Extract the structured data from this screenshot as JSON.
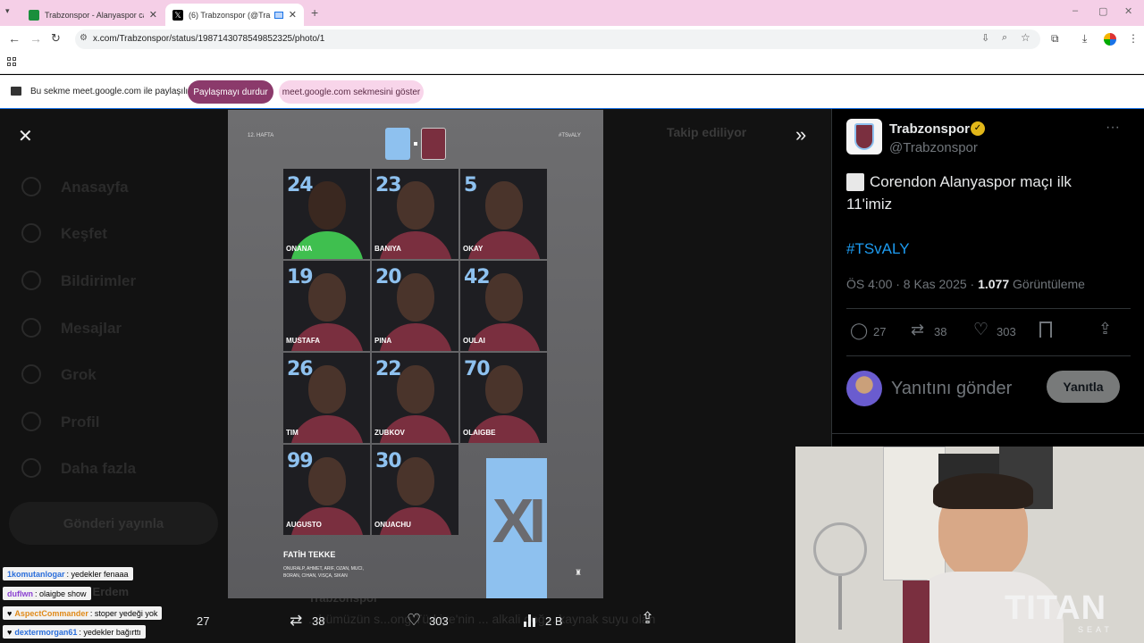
{
  "browser": {
    "tabs": [
      {
        "title": "Trabzonspor - Alanyaspor canlı",
        "favicon_color": "#1a8f3c",
        "active": false
      },
      {
        "title": "(6) Trabzonspor (@Trabzons",
        "favicon_color": "#000000",
        "active": true
      }
    ],
    "url": "x.com/Trabzonspor/status/1987143078549852325/photo/1"
  },
  "share_bar": {
    "message": "Bu sekme meet.google.com ile paylaşılıyor",
    "stop_label": "Paylaşmayı durdur",
    "show_label": "meet.google.com sekmesini göster"
  },
  "background_nav": {
    "items": [
      "Anasayfa",
      "Keşfet",
      "Bildirimler",
      "Mesajlar",
      "Grok",
      "Profil",
      "Daha fazla"
    ],
    "post_button": "Gönderi yayınla",
    "follow_label": "Takip ediliyor",
    "ghost_author": "Trabzonspor",
    "ghost_user": "n Erdem",
    "ghost_text": "...bümüzün s...ong Türkiye'nin ... alkali doğ... kaynak suyu olan"
  },
  "poster": {
    "week": "12. HAFTA",
    "hashtag": "#TSvALY",
    "players": [
      {
        "num": "24",
        "name": "ONANA"
      },
      {
        "num": "23",
        "name": "BANIYA"
      },
      {
        "num": "5",
        "name": "OKAY"
      },
      {
        "num": "19",
        "name": "MUSTAFA"
      },
      {
        "num": "20",
        "name": "PINA"
      },
      {
        "num": "42",
        "name": "OULAI"
      },
      {
        "num": "26",
        "name": "TIM"
      },
      {
        "num": "22",
        "name": "ZUBKOV"
      },
      {
        "num": "70",
        "name": "OLAIGBE"
      },
      {
        "num": "99",
        "name": "AUGUSTO"
      },
      {
        "num": "30",
        "name": "ONUACHU"
      }
    ],
    "coach": "FATİH TEKKE",
    "subs_line1": "ONURALP, AHMET, ARIF, OZAN, MUCI,",
    "subs_line2": "BORAN, CIHAN, VISÇA, SIKAN",
    "xi": "XI"
  },
  "media_actions": {
    "replies": "27",
    "reposts": "38",
    "likes": "303",
    "views": "2 B"
  },
  "tweet": {
    "display_name": "Trabzonspor",
    "handle": "@Trabzonspor",
    "text_line1": "Corendon Alanyaspor maçı ilk",
    "text_line2": "11'imiz",
    "hashtag": "#TSvALY",
    "time": "ÖS 4:00 · 8 Kas 2025 · ",
    "views_count": "1.077",
    "views_label": " Görüntüleme",
    "replies": "27",
    "reposts": "38",
    "likes": "303",
    "reply_placeholder": "Yanıtını gönder",
    "reply_button": "Yanıtla",
    "accent": "#1d9bf0"
  },
  "chat": [
    {
      "user": "1komutanlogar",
      "msg": ": yedekler fenaaa",
      "color": "#2a6edb"
    },
    {
      "user": "duflwn",
      "msg": ": olaigbe show",
      "color": "#8a3fd1"
    },
    {
      "user": "AspectCommander",
      "msg": ": stoper yedeği yok",
      "color": "#e08a1a"
    },
    {
      "user": "dextermorgan61",
      "msg": ": yedekler bağırttı",
      "color": "#2a6edb"
    }
  ],
  "webcam": {
    "brand": "TITAN",
    "brand_sub": "SEAT"
  }
}
